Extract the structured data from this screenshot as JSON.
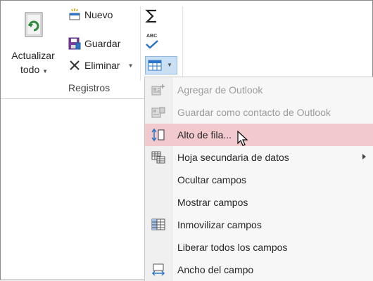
{
  "ribbon": {
    "refresh": {
      "line1": "Actualizar",
      "line2": "todo"
    },
    "new_label": "Nuevo",
    "save_label": "Guardar",
    "delete_label": "Eliminar",
    "group_label": "Registros",
    "spelling_icon_text": "ABC"
  },
  "menu": {
    "items": [
      {
        "label": "Agregar de Outlook",
        "icon": "outlook-add-icon",
        "disabled": true
      },
      {
        "label": "Guardar como contacto de Outlook",
        "icon": "outlook-save-contact-icon",
        "disabled": true
      },
      {
        "label": "Alto de fila...",
        "icon": "row-height-icon",
        "hover": true
      },
      {
        "label": "Hoja secundaria de datos",
        "icon": "subdatasheet-icon",
        "submenu": true
      },
      {
        "label": "Ocultar campos",
        "icon": ""
      },
      {
        "label": "Mostrar campos",
        "icon": ""
      },
      {
        "label": "Inmovilizar campos",
        "icon": "freeze-fields-icon"
      },
      {
        "label": "Liberar todos los campos",
        "icon": ""
      },
      {
        "label": "Ancho del campo",
        "icon": "field-width-icon"
      }
    ]
  },
  "colors": {
    "hover": "#f2c9cd",
    "accent_blue": "#2b74c7",
    "accent_red": "#d9434e",
    "refresh_green": "#2e8b3d"
  }
}
